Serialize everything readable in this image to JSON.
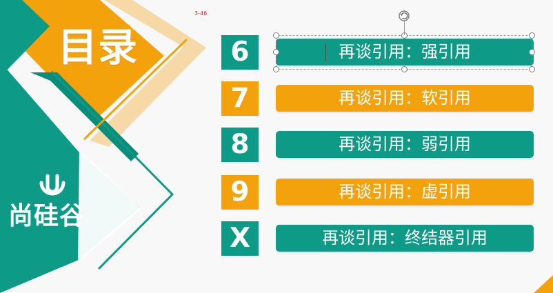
{
  "slide": {
    "title": "目录",
    "tiny_label": "3-46",
    "brand": {
      "text": "尚硅谷",
      "icon": "u-logo-icon"
    }
  },
  "toc": {
    "items": [
      {
        "number": "6",
        "label": "再谈引用：强引用",
        "color": "teal",
        "selected": true
      },
      {
        "number": "7",
        "label": "再谈引用：软引用",
        "color": "orange",
        "selected": false
      },
      {
        "number": "8",
        "label": "再谈引用：弱引用",
        "color": "teal",
        "selected": false
      },
      {
        "number": "9",
        "label": "再谈引用：虚引用",
        "color": "orange",
        "selected": false
      },
      {
        "number": "X",
        "label": "再谈引用：终结器引用",
        "color": "teal",
        "selected": false
      }
    ]
  },
  "colors": {
    "teal": "#0d9a87",
    "orange": "#f4a20b",
    "background": "#f8f8f8",
    "selection": "#8f8f8f"
  },
  "icons": {
    "rotation": "rotate-icon"
  }
}
